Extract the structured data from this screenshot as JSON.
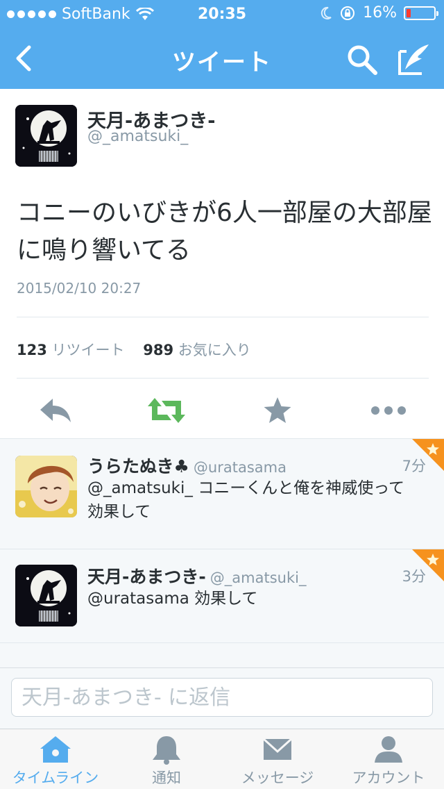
{
  "status_bar": {
    "carrier": "SoftBank",
    "time": "20:35",
    "battery_percent": "16%",
    "battery_level": 0.16
  },
  "navbar": {
    "title": "ツイート",
    "back_icon": "chevron-left-icon",
    "search_icon": "search-icon",
    "compose_icon": "compose-icon"
  },
  "tweet": {
    "author_name": "天月-あまつき-",
    "author_handle": "@_amatsuki_",
    "text": "コニーのいびきが6人一部屋の大部屋に鳴り響いてる",
    "timestamp": "2015/02/10 20:27",
    "retweet_count": "123",
    "retweet_label": "リツイート",
    "favorite_count": "989",
    "favorite_label": "お気に入り"
  },
  "actions": [
    "reply-icon",
    "retweet-icon",
    "favorite-star-icon",
    "more-icon"
  ],
  "replies": [
    {
      "name": "うらたぬき♣",
      "handle": "@uratasama",
      "time": "7分",
      "text": "@_amatsuki_ コニーくんと俺を神威使って効果して"
    },
    {
      "name": "天月-あまつき-",
      "handle": "@_amatsuki_",
      "time": "3分",
      "text": "@uratasama 効果して"
    }
  ],
  "reply_input": {
    "placeholder": "天月-あまつき- に返信"
  },
  "tabbar": {
    "items": [
      {
        "label": "タイムライン",
        "icon": "home-icon",
        "active": true
      },
      {
        "label": "通知",
        "icon": "bell-icon",
        "active": false
      },
      {
        "label": "メッセージ",
        "icon": "envelope-icon",
        "active": false
      },
      {
        "label": "アカウント",
        "icon": "person-icon",
        "active": false
      }
    ]
  },
  "colors": {
    "brand_blue": "#55acee",
    "retweet_green": "#5cb85c",
    "favorite_orange": "#f6921e",
    "icon_gray": "#8899a6"
  }
}
